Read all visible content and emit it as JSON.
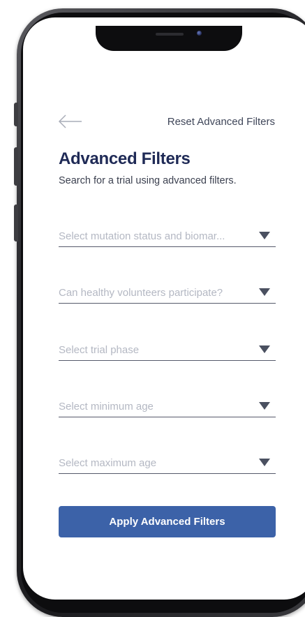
{
  "header": {
    "back_icon": "arrow-left-icon",
    "reset_label": "Reset Advanced Filters"
  },
  "title": "Advanced Filters",
  "subtitle": "Search for a trial using advanced filters.",
  "filters": [
    {
      "placeholder": "Select mutation status and biomar...",
      "icon": "caret-down-icon"
    },
    {
      "placeholder": "Can healthy volunteers participate?",
      "icon": "caret-down-icon"
    },
    {
      "placeholder": "Select trial phase",
      "icon": "caret-down-icon"
    },
    {
      "placeholder": "Select minimum age",
      "icon": "caret-down-icon"
    },
    {
      "placeholder": "Select maximum age",
      "icon": "caret-down-icon"
    }
  ],
  "apply_label": "Apply Advanced Filters",
  "colors": {
    "primary": "#3c62a8",
    "title": "#1f2a56",
    "placeholder": "#b4b8c3",
    "underline": "#55596a"
  }
}
